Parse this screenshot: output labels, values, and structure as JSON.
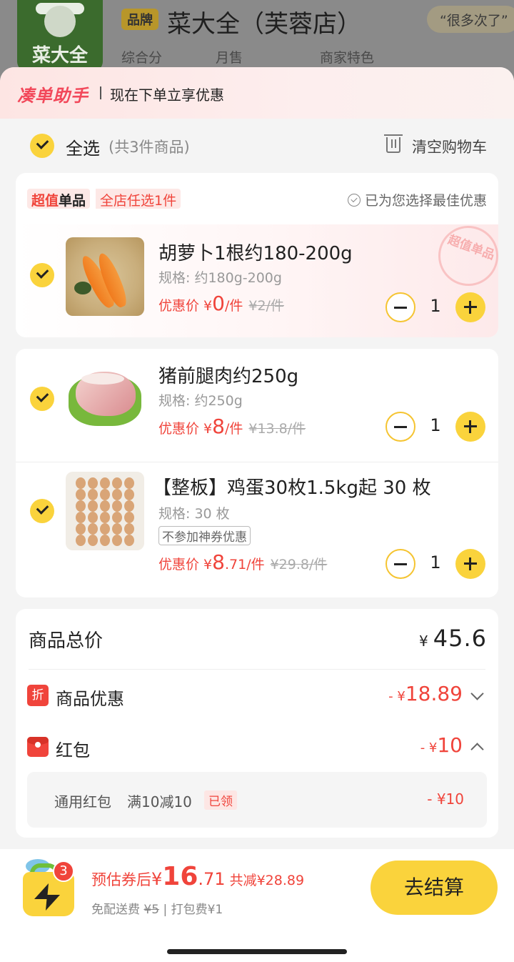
{
  "store": {
    "logo_text": "菜大全",
    "brand_tag": "品牌",
    "name": "菜大全（芙蓉店）",
    "review_tag": "“很多次了”",
    "stats": [
      "综合分",
      "月售",
      "商家特色"
    ]
  },
  "helper": {
    "logo": "凑单助手",
    "text": "现在下单立享优惠"
  },
  "cart": {
    "select_all": "全选",
    "count_text": "(共3件商品)",
    "clear": "清空购物车"
  },
  "deal": {
    "badge_red": "超值",
    "badge_dark": "单品",
    "sub": "全店任选1件",
    "best": "已为您选择最佳优惠",
    "stamp": "超值单品"
  },
  "items": [
    {
      "name": "胡萝卜1根约180-200g",
      "spec": "规格: 约180g-200g",
      "price_label": "优惠价 ¥",
      "price": "0",
      "price_unit": "/件",
      "original": "¥2/件",
      "qty": "1"
    },
    {
      "name": "猪前腿肉约250g",
      "spec": "规格: 约250g",
      "price_label": "优惠价 ¥",
      "price": "8",
      "price_unit": "/件",
      "original": "¥13.8/件",
      "qty": "1"
    },
    {
      "name": "【整板】鸡蛋30枚1.5kg起 30 枚",
      "spec": "规格: 30 枚",
      "tag": "不参加神券优惠",
      "price_label": "优惠价 ¥",
      "price": "8",
      "price_decimal": ".71",
      "price_unit": "/件",
      "original": "¥29.8/件",
      "qty": "1"
    }
  ],
  "summary": {
    "total_label": "商品总价",
    "total_symbol": "¥",
    "total_value": "45.6",
    "discount_icon": "折",
    "discount_label": "商品优惠",
    "discount_prefix": "- ",
    "discount_symbol": "¥",
    "discount_value": "18.89",
    "hongbao_label": "红包",
    "hongbao_prefix": "- ",
    "hongbao_symbol": "¥",
    "hongbao_value": "10",
    "hb_name": "通用红包",
    "hb_rule": "满10减10",
    "hb_claimed": "已领",
    "hb_amount": "- ¥10"
  },
  "bottom": {
    "badge_count": "3",
    "est_label": "预估券后",
    "est_symbol": "¥",
    "est_int": "16",
    "est_decimal": ".71",
    "saved": "共减¥28.89",
    "free_delivery": "免配送费",
    "delivery_strike": "¥5",
    "packing": "| 打包费¥1",
    "checkout": "去结算"
  },
  "colors": {
    "accent_yellow": "#fad33c",
    "price_red": "#f0443b"
  },
  "icons": [
    "check-icon",
    "trash-icon",
    "minus-icon",
    "plus-icon",
    "discount-icon",
    "red-packet-icon",
    "chevron-down-icon",
    "chevron-up-icon",
    "shopping-bag-icon"
  ]
}
